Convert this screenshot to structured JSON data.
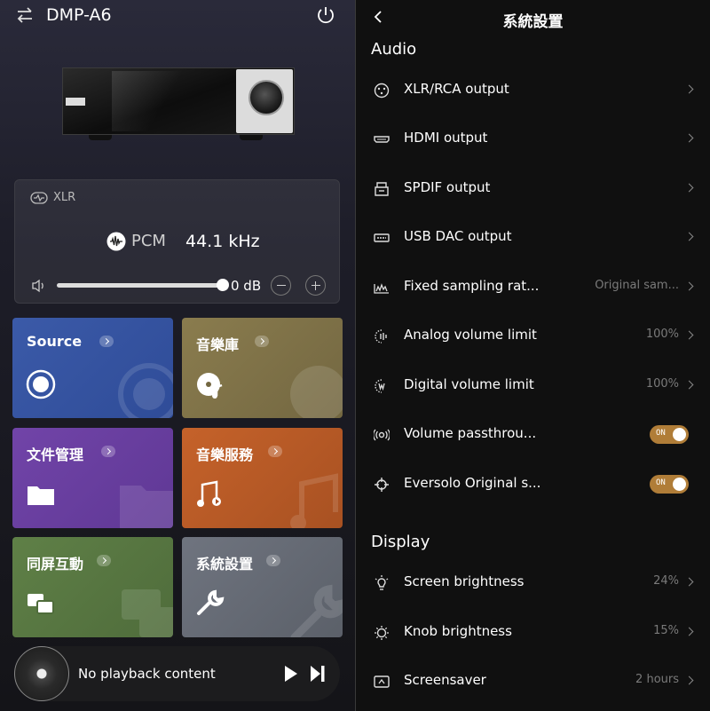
{
  "left": {
    "device_name": "DMP-A6",
    "output_label": "XLR",
    "format_label": "PCM",
    "sample_rate": "44.1 kHz",
    "volume_label": "0 dB",
    "volume_level_fraction": 1.0,
    "tiles": [
      {
        "id": "source",
        "label": "Source",
        "color": "#3b5aa8",
        "icon": "radio-button-icon"
      },
      {
        "id": "library",
        "label": "音樂庫",
        "color": "#8a7c4e",
        "icon": "disc-music-icon"
      },
      {
        "id": "files",
        "label": "文件管理",
        "color": "#7144a8",
        "icon": "folder-icon"
      },
      {
        "id": "services",
        "label": "音樂服務",
        "color": "#c5622a",
        "icon": "music-note-icon"
      },
      {
        "id": "mirror",
        "label": "同屏互動",
        "color": "#5f8047",
        "icon": "screen-mirror-icon"
      },
      {
        "id": "settings",
        "label": "系統設置",
        "color": "#6f747f",
        "icon": "wrench-icon"
      }
    ],
    "player": {
      "status": "No playback content"
    }
  },
  "right": {
    "title": "系統設置",
    "sections": [
      {
        "title": "Audio",
        "rows": [
          {
            "label": "XLR/RCA output",
            "value": "",
            "control": "chevron",
            "icon": "xlr-connector-icon"
          },
          {
            "label": "HDMI output",
            "value": "",
            "control": "chevron",
            "icon": "hdmi-icon"
          },
          {
            "label": "SPDIF output",
            "value": "",
            "control": "chevron",
            "icon": "spdif-icon"
          },
          {
            "label": "USB DAC output",
            "value": "",
            "control": "chevron",
            "icon": "usb-icon"
          },
          {
            "label": "Fixed sampling rat...",
            "value": "Original sam...",
            "control": "chevron",
            "icon": "waveform-icon"
          },
          {
            "label": "Analog volume limit",
            "value": "100%",
            "control": "chevron",
            "icon": "analog-volume-icon"
          },
          {
            "label": "Digital volume limit",
            "value": "100%",
            "control": "chevron",
            "icon": "digital-volume-icon"
          },
          {
            "label": "Volume passthrou...",
            "value": "ON",
            "control": "toggle",
            "icon": "passthrough-icon"
          },
          {
            "label": "Eversolo Original s...",
            "value": "ON",
            "control": "toggle",
            "icon": "eversolo-icon"
          }
        ]
      },
      {
        "title": "Display",
        "rows": [
          {
            "label": "Screen brightness",
            "value": "24%",
            "control": "chevron",
            "icon": "sun-icon"
          },
          {
            "label": "Knob brightness",
            "value": "15%",
            "control": "chevron",
            "icon": "sun-small-icon"
          },
          {
            "label": "Screensaver",
            "value": "2 hours",
            "control": "chevron",
            "icon": "screensaver-icon"
          }
        ]
      }
    ],
    "accent_toggle_color": "#b07d38"
  }
}
